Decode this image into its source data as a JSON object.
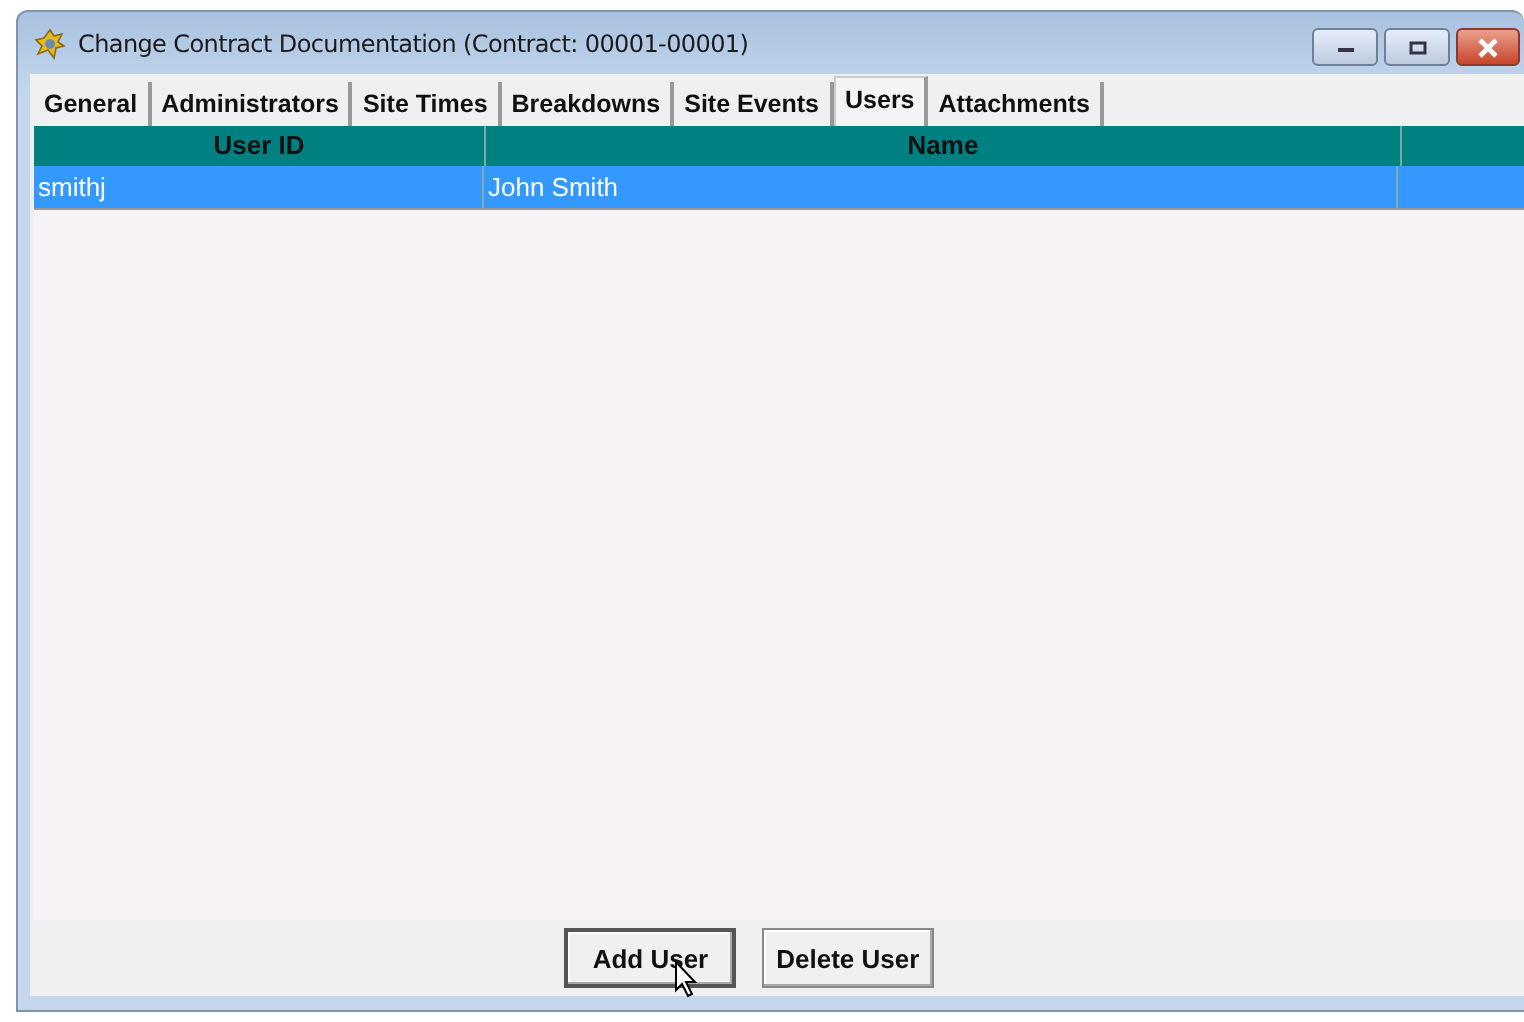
{
  "window": {
    "title": "Change Contract Documentation (Contract: 00001-00001)"
  },
  "tabs": [
    {
      "label": "General",
      "selected": false
    },
    {
      "label": "Administrators",
      "selected": false
    },
    {
      "label": "Site Times",
      "selected": false
    },
    {
      "label": "Breakdowns",
      "selected": false
    },
    {
      "label": "Site Events",
      "selected": false
    },
    {
      "label": "Users",
      "selected": true
    },
    {
      "label": "Attachments",
      "selected": false
    }
  ],
  "table": {
    "columns": [
      "User ID",
      "Name"
    ],
    "rows": [
      {
        "cells": [
          "smithj",
          "John Smith"
        ],
        "selected": true
      }
    ]
  },
  "buttons": [
    "Add User",
    "Delete User"
  ]
}
